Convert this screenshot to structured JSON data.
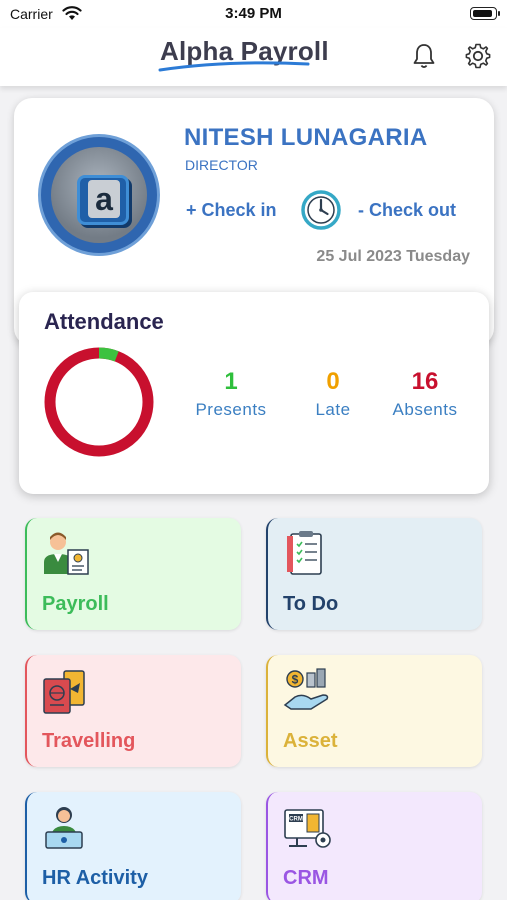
{
  "status_bar": {
    "carrier": "Carrier",
    "time": "3:49 PM"
  },
  "header": {
    "title_part1": "Alpha",
    "title_part2": "Payroll"
  },
  "profile": {
    "name": "NITESH LUNAGARIA",
    "role": "DIRECTOR",
    "check_in_label": "+ Check in",
    "check_out_label": "- Check out",
    "date": "25 Jul 2023 Tuesday"
  },
  "attendance": {
    "title": "Attendance",
    "presents": {
      "value": "1",
      "label": "Presents",
      "color": "#2fbf3c"
    },
    "late": {
      "value": "0",
      "label": "Late",
      "color": "#f0a000"
    },
    "absents": {
      "value": "16",
      "label": "Absents",
      "color": "#c8102e"
    },
    "donut_colors": {
      "present": "#3cc23f",
      "absent": "#c8102e"
    }
  },
  "tiles": [
    {
      "label": "Payroll",
      "icon": "employee-salary-icon",
      "bg": "#e4fbe3",
      "border": "#3cbc5a",
      "text": "#3cbc5a"
    },
    {
      "label": "To Do",
      "icon": "clipboard-checklist-icon",
      "bg": "#e3eef4",
      "border": "#23426b",
      "text": "#23426b"
    },
    {
      "label": "Travelling",
      "icon": "passport-ticket-icon",
      "bg": "#fde8ea",
      "border": "#e3565c",
      "text": "#e3565c"
    },
    {
      "label": "Asset",
      "icon": "asset-hand-icon",
      "bg": "#fdf8e2",
      "border": "#dbb23a",
      "text": "#dbb23a"
    },
    {
      "label": "HR Activity",
      "icon": "hr-laptop-icon",
      "bg": "#e3f2fd",
      "border": "#1d5fa6",
      "text": "#1d5fa6"
    },
    {
      "label": "CRM",
      "icon": "crm-monitor-icon",
      "bg": "#f3e8fd",
      "border": "#9a56e3",
      "text": "#9a56e3"
    }
  ]
}
